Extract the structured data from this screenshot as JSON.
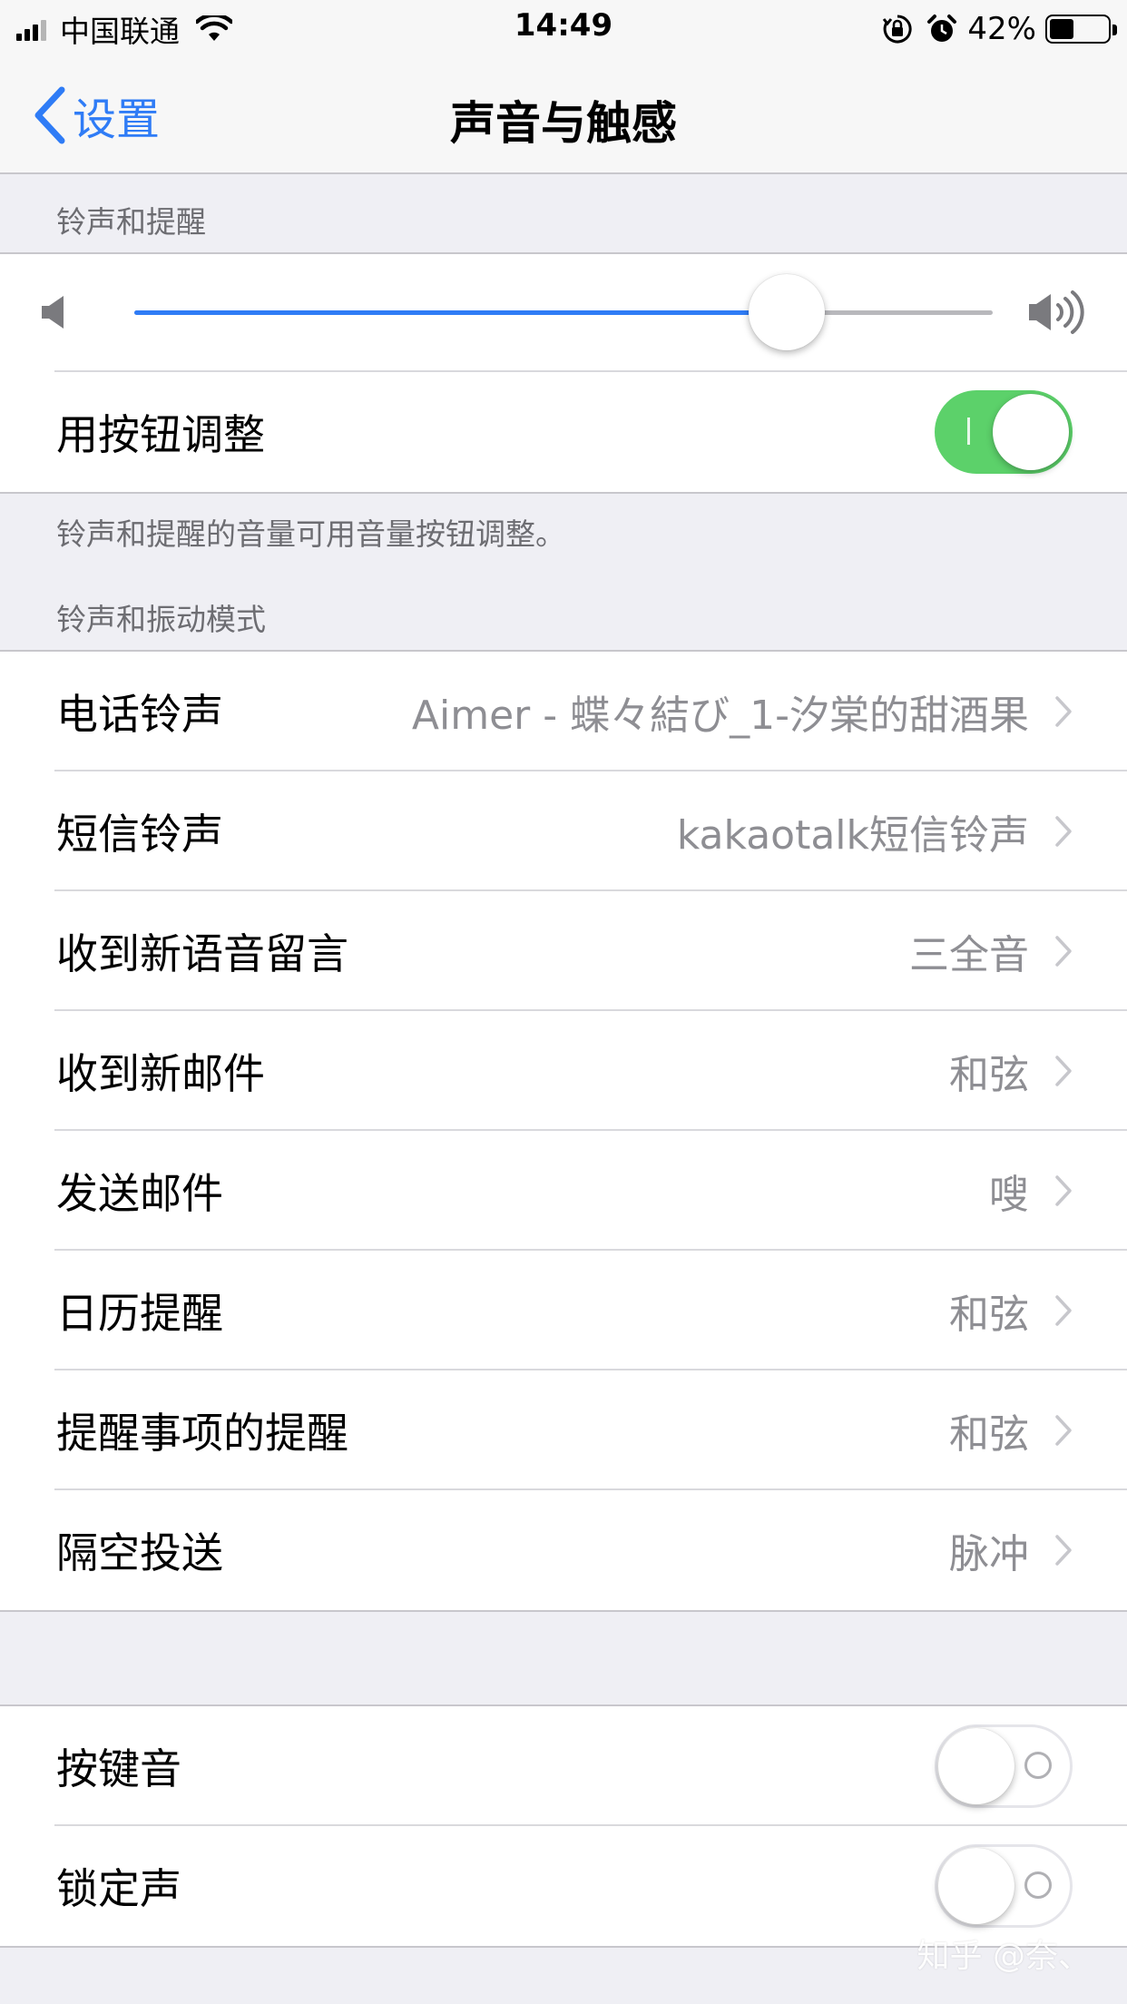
{
  "status_bar": {
    "carrier": "中国联通",
    "time": "14:49",
    "battery_percent": "42%",
    "battery_level": 0.42,
    "icons": [
      "signal-icon",
      "wifi-icon",
      "orientation-lock-icon",
      "alarm-icon",
      "battery-icon"
    ]
  },
  "nav": {
    "back_label": "设置",
    "title": "声音与触感"
  },
  "ringer_section": {
    "header": "铃声和提醒",
    "volume_level": 0.76,
    "change_with_buttons_label": "用按钮调整",
    "change_with_buttons_on": true,
    "footer": "铃声和提醒的音量可用音量按钮调整。"
  },
  "patterns_section": {
    "header": "铃声和振动模式",
    "items": [
      {
        "label": "电话铃声",
        "value": "Aimer - 蝶々結び_1-汐棠的甜酒果"
      },
      {
        "label": "短信铃声",
        "value": "kakaotalk短信铃声"
      },
      {
        "label": "收到新语音留言",
        "value": "三全音"
      },
      {
        "label": "收到新邮件",
        "value": "和弦"
      },
      {
        "label": "发送邮件",
        "value": "嗖"
      },
      {
        "label": "日历提醒",
        "value": "和弦"
      },
      {
        "label": "提醒事项的提醒",
        "value": "和弦"
      },
      {
        "label": "隔空投送",
        "value": "脉冲"
      }
    ]
  },
  "sounds_section": {
    "items": [
      {
        "label": "按键音",
        "on": false
      },
      {
        "label": "锁定声",
        "on": false
      }
    ]
  },
  "watermark": "知乎 @奈、",
  "colors": {
    "accent": "#2f7cf6",
    "toggle_on": "#5cd16a",
    "background": "#efeff4",
    "secondary_text": "#8e8e93"
  }
}
